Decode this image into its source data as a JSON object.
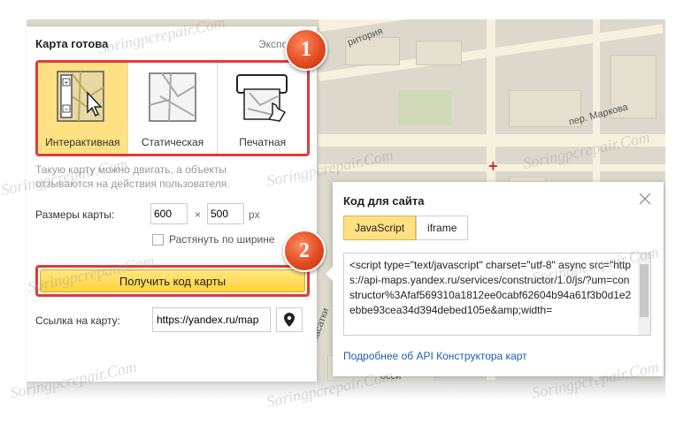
{
  "panel": {
    "title": "Карта готова",
    "export_label": "Экспорт"
  },
  "map_types": [
    {
      "label": "Интерактивная",
      "selected": true
    },
    {
      "label": "Статическая",
      "selected": false
    },
    {
      "label": "Печатная",
      "selected": false
    }
  ],
  "hint": "Такую карту можно двигать, а объекты отзываются на действия пользователя.",
  "size": {
    "label": "Размеры карты:",
    "width": "600",
    "height": "500",
    "separator": "×",
    "unit": "px",
    "stretch_label": "Растянуть по ширине"
  },
  "get_code_button": "Получить код карты",
  "map_link": {
    "label": "Ссылка на карту:",
    "value": "https://yandex.ru/map"
  },
  "badges": [
    "1",
    "2"
  ],
  "code_popup": {
    "title": "Код для сайта",
    "tabs": [
      {
        "label": "JavaScript",
        "active": true
      },
      {
        "label": "iframe",
        "active": false
      }
    ],
    "code": "<script type=\"text/javascript\" charset=\"utf-8\" async src=\"https://api-maps.yandex.ru/services/constructor/1.0/js/?um=constructor%3Afaf569310a1812ee0cabf62604b94a61f3b0d1e2ebbe93cea34d394debed105e&amp;width=",
    "api_link": "Подробнее об API Конструктора карт"
  },
  "map_labels": {
    "street1": "ритория",
    "street2": "пер. Маркова",
    "street3": "Касатки",
    "street4": "осси"
  },
  "watermark": "Soringpcrepair.Com",
  "colors": {
    "accent_yellow": "#ffe082",
    "highlight_red": "#e03a3a",
    "badge_orange": "#e0471e",
    "link_blue": "#1a5fb4"
  }
}
